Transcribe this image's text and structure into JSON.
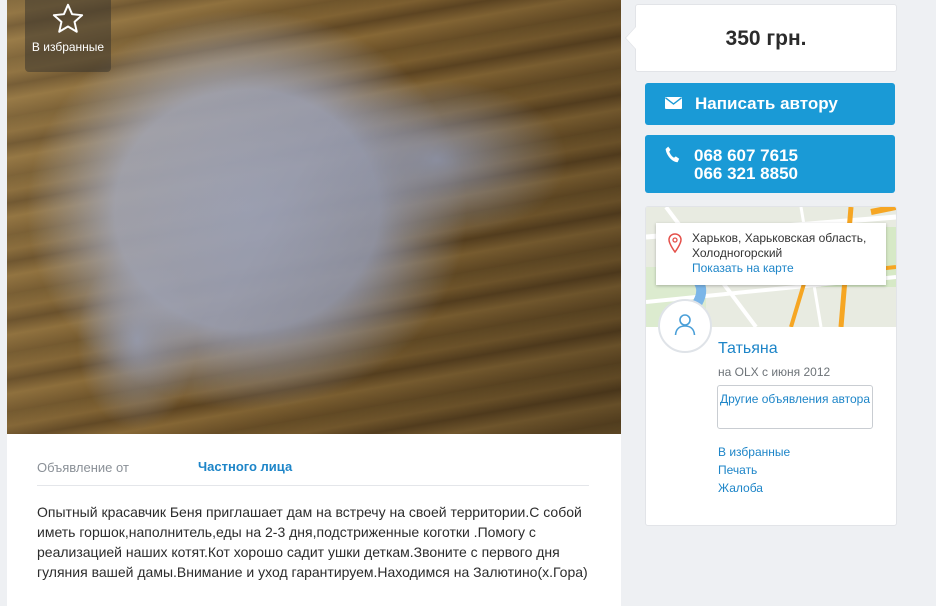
{
  "photo": {
    "favorite_label": "В избранные"
  },
  "details": {
    "offer_from_key": "Объявление от",
    "offer_from_value": "Частного лица",
    "description": "Опытный красавчик Беня приглашает дам на встречу на своей территории.С собой иметь горшок,наполнитель,еды на 2-3 дня,подстриженные коготки .Помогу с реализацией наших котят.Кот хорошо садит ушки деткам.Звоните с первого дня гуляния вашей дамы.Внимание и уход гарантируем.Находимся на Залютино(х.Гора)"
  },
  "sidebar": {
    "price": "350 грн.",
    "message_button": "Написать автору",
    "phones": [
      "068 607 7615",
      "066 321 8850"
    ],
    "location": {
      "address": "Харьков, Харьковская область, Холодногорский",
      "map_link": "Показать на карте"
    },
    "seller": {
      "name": "Татьяна",
      "member_since": "на OLX с июня 2012",
      "other_ads": "Другие объявления автора"
    },
    "links": [
      "В избранные",
      "Печать",
      "Жалоба"
    ]
  },
  "colors": {
    "accent": "#1a9ad6",
    "link": "#1d85c8",
    "background": "#eef0f3"
  },
  "icons": [
    "star-icon",
    "envelope-icon",
    "phone-icon",
    "map-pin-icon",
    "user-icon"
  ]
}
